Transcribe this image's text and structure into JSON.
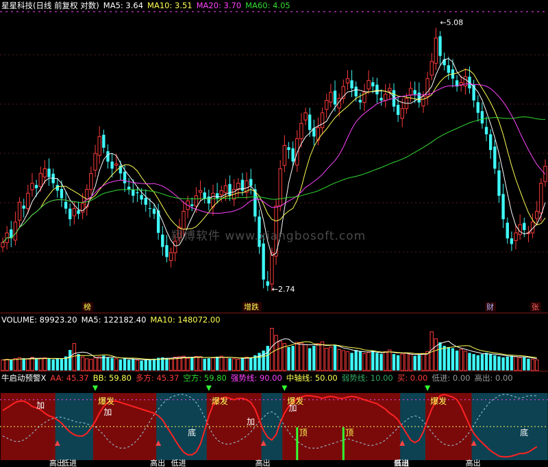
{
  "header": {
    "title": "星星科技(日线 前复权 对数)",
    "ma5": "MA5: 3.64",
    "ma10": "MA10: 3.51",
    "ma20": "MA20: 3.70",
    "ma60": "MA60: 4.05"
  },
  "price_panel": {
    "high_label": "5.08",
    "low_label": "2.74",
    "markers": [
      "榜",
      "增跌",
      "财",
      "张"
    ]
  },
  "volume_header": {
    "volume": "VOLUME: 89923.20",
    "ma5": "MA5: 122182.40",
    "ma10": "MA10: 148072.00"
  },
  "indicator_header": {
    "name": "牛启动预警X",
    "aa": "AA: 45.37",
    "bb": "BB: 59.80",
    "duo": "多方: 45.37",
    "kong": "空方: 59.80",
    "strong": "强势线: 90.00",
    "mid": "中轴线: 50.00",
    "weak": "弱势线: 10.00",
    "buy": "买: 0.00",
    "lowin": "低进: 0.00",
    "highout": "高出: 0.00"
  },
  "watermark": "翔博软件 www.xiangbosoft.com",
  "signal_labels": {
    "add": "加",
    "burst": "爆发",
    "bottom": "底",
    "top": "顶",
    "high_out": "高出",
    "low_in": "低进"
  },
  "colors": {
    "up": "#ff3b3b",
    "down": "#3ff7f7",
    "ma5": "#ffffff",
    "ma10": "#ffff55",
    "ma20": "#ff44ff",
    "ma60": "#33dd33",
    "bull_zone": "#7a0a0a",
    "bear_zone": "#0d4252",
    "aa_line": "#ff2222",
    "bb_line": "#9ad0e0"
  },
  "chart_data": [
    {
      "type": "candlestick",
      "title": "星星科技(日线 前复权 对数)",
      "series_names": [
        "MA5",
        "MA10",
        "MA20",
        "MA60"
      ],
      "ylim": [
        2.6,
        5.2
      ],
      "annotations": [
        {
          "text": "5.08",
          "value": 5.08
        },
        {
          "text": "2.74",
          "value": 2.74
        }
      ],
      "close": [
        3.05,
        3.12,
        3.08,
        3.2,
        3.35,
        3.3,
        3.42,
        3.5,
        3.46,
        3.58,
        3.62,
        3.55,
        3.5,
        3.44,
        3.38,
        3.3,
        3.22,
        3.3,
        3.26,
        3.34,
        3.45,
        3.58,
        3.75,
        3.9,
        3.8,
        3.68,
        3.62,
        3.66,
        3.58,
        3.5,
        3.45,
        3.4,
        3.42,
        3.37,
        3.33,
        3.3,
        3.26,
        3.12,
        3.02,
        2.95,
        2.98,
        3.06,
        3.16,
        3.28,
        3.36,
        3.32,
        3.4,
        3.44,
        3.38,
        3.34,
        3.42,
        3.38,
        3.44,
        3.48,
        3.4,
        3.45,
        3.5,
        3.44,
        3.52,
        3.48,
        3.24,
        3.02,
        2.8,
        2.76,
        2.98,
        3.32,
        3.62,
        3.82,
        3.78,
        3.68,
        3.88,
        4.02,
        4.12,
        3.96,
        3.9,
        3.98,
        4.12,
        4.24,
        4.32,
        4.2,
        4.26,
        4.38,
        4.46,
        4.36,
        4.28,
        4.22,
        4.32,
        4.44,
        4.38,
        4.3,
        4.24,
        4.3,
        4.36,
        4.18,
        4.1,
        4.16,
        4.26,
        4.36,
        4.3,
        4.22,
        4.28,
        4.46,
        4.64,
        4.9,
        4.7,
        4.6,
        4.52,
        4.46,
        4.38,
        4.42,
        4.48,
        4.36,
        4.24,
        4.12,
        4.02,
        3.92,
        3.78,
        3.62,
        3.4,
        3.22,
        3.08,
        3.04,
        3.12,
        3.18,
        3.14,
        3.12,
        3.2,
        3.28,
        3.5,
        3.64
      ],
      "volume": [
        90,
        95,
        88,
        102,
        110,
        104,
        99,
        112,
        96,
        105,
        108,
        100,
        94,
        102,
        98,
        120,
        175,
        230,
        140,
        115,
        100,
        95,
        108,
        118,
        126,
        112,
        106,
        100,
        94,
        104,
        92,
        98,
        88,
        84,
        90,
        96,
        100,
        108,
        112,
        106,
        100,
        114,
        118,
        122,
        104,
        110,
        120,
        118,
        100,
        104,
        108,
        118,
        122,
        112,
        104,
        100,
        96,
        110,
        114,
        108,
        130,
        150,
        170,
        210,
        360,
        300,
        250,
        230,
        200,
        210,
        240,
        235,
        220,
        190,
        210,
        230,
        245,
        190,
        200,
        220,
        180,
        170,
        160,
        150,
        175,
        165,
        145,
        155,
        168,
        150,
        142,
        160,
        175,
        140,
        130,
        140,
        150,
        138,
        125,
        132,
        145,
        160,
        330,
        270,
        240,
        210,
        200,
        190,
        170,
        180,
        165,
        150,
        140,
        130,
        140,
        150,
        142,
        130,
        120,
        112,
        118,
        126,
        118,
        108,
        112,
        100,
        95,
        90
      ],
      "ylabel": ""
    },
    {
      "type": "bar",
      "title": "VOLUME",
      "series_names": [
        "VOLUME",
        "MA5",
        "MA10"
      ],
      "values_ref": "chart_data[0].volume",
      "latest": {
        "VOLUME": 89923.2,
        "MA5": 122182.4,
        "MA10": 148072.0
      }
    },
    {
      "type": "line",
      "title": "牛启动预警X",
      "ylim": [
        0,
        100
      ],
      "levels": {
        "strong": 90,
        "mid": 50,
        "weak": 10
      },
      "aa": [
        74,
        78,
        82,
        86,
        88,
        88,
        85,
        80,
        78,
        75,
        70,
        66,
        64,
        60,
        55,
        48,
        42,
        38,
        36,
        36,
        40,
        48,
        58,
        70,
        80,
        86,
        88,
        88,
        86,
        84,
        82,
        80,
        78,
        76,
        74,
        72,
        70,
        66,
        60,
        50,
        40,
        30,
        20,
        12,
        8,
        8,
        12,
        24,
        44,
        66,
        82,
        90,
        92,
        94,
        92,
        90,
        92,
        92,
        90,
        86,
        76,
        60,
        44,
        34,
        30,
        38,
        56,
        70,
        80,
        86,
        92,
        94,
        96,
        96,
        95,
        94,
        92,
        94,
        95,
        94,
        92,
        92,
        94,
        95,
        94,
        92,
        90,
        88,
        86,
        84,
        80,
        76,
        70,
        66,
        60,
        50,
        40,
        30,
        26,
        30,
        42,
        60,
        76,
        88,
        96,
        98,
        96,
        94,
        90,
        80,
        66,
        52,
        40,
        32,
        26,
        20,
        14,
        10,
        6,
        5,
        5,
        6,
        8,
        10,
        10,
        12,
        16,
        20
      ],
      "bb": [
        36,
        33,
        30,
        28,
        28,
        30,
        34,
        40,
        46,
        52,
        56,
        60,
        62,
        64,
        64,
        62,
        60,
        58,
        56,
        56,
        54,
        52,
        50,
        44,
        38,
        30,
        24,
        20,
        18,
        18,
        20,
        24,
        30,
        38,
        48,
        58,
        68,
        76,
        84,
        90,
        94,
        96,
        98,
        98,
        96,
        92,
        86,
        76,
        64,
        50,
        38,
        30,
        26,
        24,
        24,
        26,
        28,
        32,
        36,
        42,
        50,
        58,
        64,
        70,
        72,
        68,
        60,
        52,
        42,
        34,
        28,
        24,
        20,
        18,
        18,
        18,
        20,
        22,
        24,
        26,
        28,
        30,
        32,
        30,
        28,
        26,
        24,
        22,
        22,
        24,
        26,
        30,
        36,
        42,
        48,
        54,
        60,
        64,
        66,
        64,
        58,
        50,
        42,
        34,
        28,
        24,
        22,
        22,
        24,
        28,
        34,
        42,
        52,
        62,
        72,
        80,
        88,
        92,
        96,
        98,
        98,
        96,
        94,
        92,
        94,
        96,
        96,
        96
      ]
    }
  ]
}
